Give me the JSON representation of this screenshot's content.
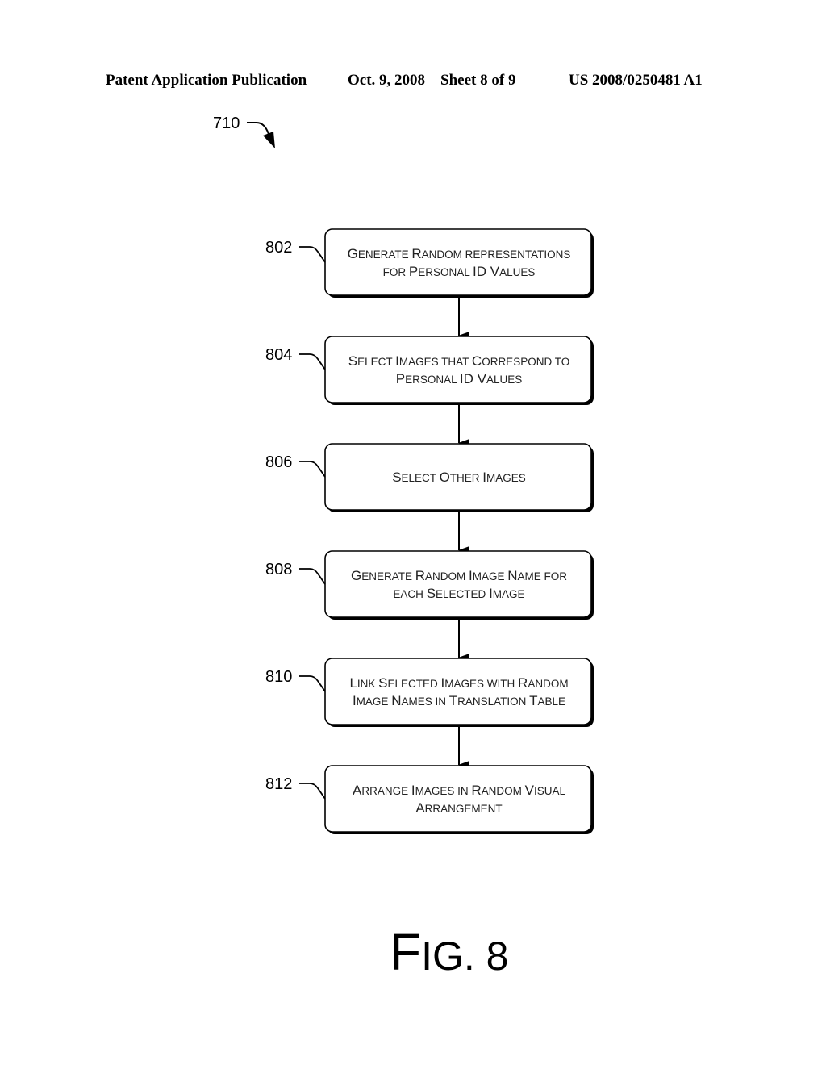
{
  "header": {
    "left": "Patent Application Publication",
    "middle": "Oct. 9, 2008    Sheet 8 of 9",
    "right": "US 2008/0250481 A1"
  },
  "diagram": {
    "reference": "710",
    "figure_label": {
      "first": "F",
      "rest": "IG. 8"
    },
    "steps": [
      {
        "ref": "802",
        "lines": [
          [
            [
              "G",
              "large"
            ],
            [
              "ENERATE ",
              "small"
            ],
            [
              "R",
              "large"
            ],
            [
              "ANDOM REPRESENTATIONS",
              "small"
            ]
          ],
          [
            [
              "FOR ",
              "small"
            ],
            [
              "P",
              "large"
            ],
            [
              "ERSONAL ",
              "small"
            ],
            [
              "ID ",
              "large"
            ],
            [
              "V",
              "large"
            ],
            [
              "ALUES",
              "small"
            ]
          ]
        ],
        "text": "Generate Random representations for Personal ID Values"
      },
      {
        "ref": "804",
        "lines": [
          [
            [
              "S",
              "large"
            ],
            [
              "ELECT ",
              "small"
            ],
            [
              "I",
              "large"
            ],
            [
              "MAGES THAT ",
              "small"
            ],
            [
              "C",
              "large"
            ],
            [
              "ORRESPOND TO",
              "small"
            ]
          ],
          [
            [
              "P",
              "large"
            ],
            [
              "ERSONAL ",
              "small"
            ],
            [
              "ID ",
              "large"
            ],
            [
              "V",
              "large"
            ],
            [
              "ALUES",
              "small"
            ]
          ]
        ],
        "text": "Select Images that Correspond to Personal ID Values"
      },
      {
        "ref": "806",
        "lines": [
          [
            [
              "S",
              "large"
            ],
            [
              "ELECT ",
              "small"
            ],
            [
              "O",
              "large"
            ],
            [
              "THER ",
              "small"
            ],
            [
              "I",
              "large"
            ],
            [
              "MAGES",
              "small"
            ]
          ]
        ],
        "text": "Select Other Images"
      },
      {
        "ref": "808",
        "lines": [
          [
            [
              "G",
              "large"
            ],
            [
              "ENERATE ",
              "small"
            ],
            [
              "R",
              "large"
            ],
            [
              "ANDOM ",
              "small"
            ],
            [
              "I",
              "large"
            ],
            [
              "MAGE ",
              "small"
            ],
            [
              "N",
              "large"
            ],
            [
              "AME FOR",
              "small"
            ]
          ],
          [
            [
              "EACH ",
              "small"
            ],
            [
              "S",
              "large"
            ],
            [
              "ELECTED ",
              "small"
            ],
            [
              "I",
              "large"
            ],
            [
              "MAGE",
              "small"
            ]
          ]
        ],
        "text": "Generate Random Image Name for each Selected Image"
      },
      {
        "ref": "810",
        "lines": [
          [
            [
              "L",
              "large"
            ],
            [
              "INK ",
              "small"
            ],
            [
              "S",
              "large"
            ],
            [
              "ELECTED ",
              "small"
            ],
            [
              "I",
              "large"
            ],
            [
              "MAGES WITH ",
              "small"
            ],
            [
              "R",
              "large"
            ],
            [
              "ANDOM",
              "small"
            ]
          ],
          [
            [
              "I",
              "large"
            ],
            [
              "MAGE ",
              "small"
            ],
            [
              "N",
              "large"
            ],
            [
              "AMES IN ",
              "small"
            ],
            [
              "T",
              "large"
            ],
            [
              "RANSLATION ",
              "small"
            ],
            [
              "T",
              "large"
            ],
            [
              "ABLE",
              "small"
            ]
          ]
        ],
        "text": "Link Selected Images with Random Image Names in Translation Table"
      },
      {
        "ref": "812",
        "lines": [
          [
            [
              "A",
              "large"
            ],
            [
              "RRANGE ",
              "small"
            ],
            [
              "I",
              "large"
            ],
            [
              "MAGES IN ",
              "small"
            ],
            [
              "R",
              "large"
            ],
            [
              "ANDOM ",
              "small"
            ],
            [
              "V",
              "large"
            ],
            [
              "ISUAL",
              "small"
            ]
          ],
          [
            [
              "A",
              "large"
            ],
            [
              "RRANGEMENT",
              "small"
            ]
          ]
        ],
        "text": "Arrange Images in Random Visual Arrangement"
      }
    ]
  }
}
